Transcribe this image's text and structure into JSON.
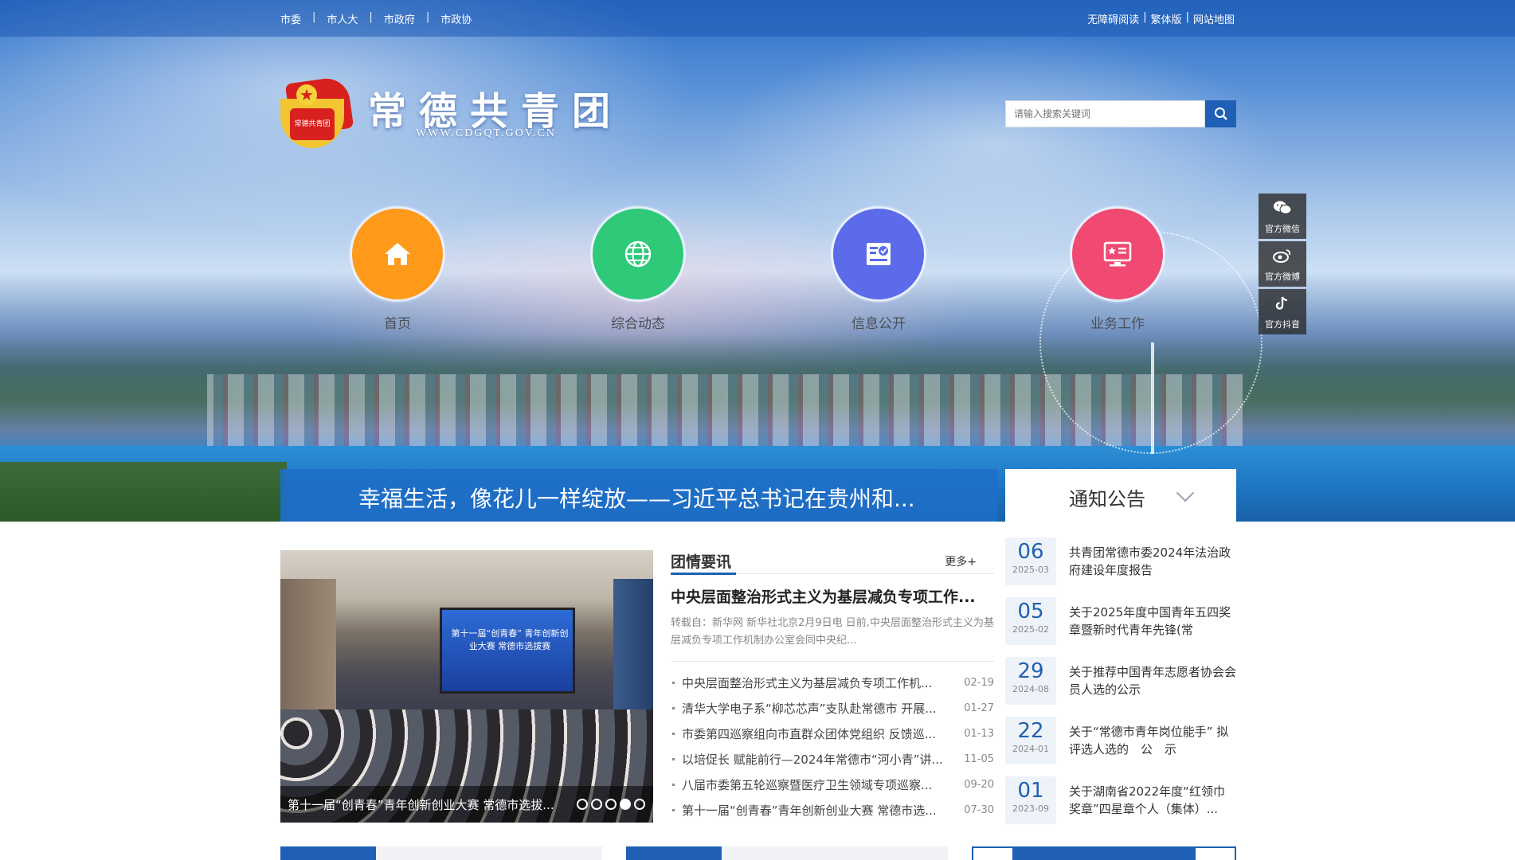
{
  "top_nav": {
    "left": [
      "市委",
      "市人大",
      "市政府",
      "市政协"
    ],
    "right": [
      "无障碍阅读",
      "繁体版",
      "网站地图"
    ]
  },
  "header": {
    "title": "常德共青团",
    "subtitle": "WWW.CDGQT.GOV.CN",
    "logo_text": "常德共青团"
  },
  "search": {
    "placeholder": "请输入搜索关键词"
  },
  "main_nav": [
    {
      "label": "首页",
      "color": "#ff9a1a",
      "icon": "home-icon"
    },
    {
      "label": "综合动态",
      "color": "#2fc97a",
      "icon": "globe-icon"
    },
    {
      "label": "信息公开",
      "color": "#5b6bea",
      "icon": "document-check-icon"
    },
    {
      "label": "业务工作",
      "color": "#f04a72",
      "icon": "monitor-star-icon"
    }
  ],
  "side_float": [
    {
      "label": "官方微信",
      "icon": "wechat-icon"
    },
    {
      "label": "官方微博",
      "icon": "weibo-icon"
    },
    {
      "label": "官方抖音",
      "icon": "douyin-icon"
    }
  ],
  "headline": {
    "text": "幸福生活，像花儿一样绽放——习近平总书记在贵州和..."
  },
  "notice_tab": {
    "label": "通知公告"
  },
  "slider": {
    "caption": "第十一届“创青春”青年创新创业大赛 常德市选拔...",
    "screen_text": "第十一届“创青春” 青年创新创业大赛 常德市选拔赛",
    "dots": 5,
    "active_dot": 4
  },
  "news": {
    "heading": "团情要讯",
    "more": "更多+",
    "top_title": "中央层面整治形式主义为基层减负专项工作...",
    "top_summary": "转载自：新华网 新华社北京2月9日电 日前,中央层面整治形式主义为基层减负专项工作机制办公室会同中央纪...",
    "items": [
      {
        "title": "中央层面整治形式主义为基层减负专项工作机...",
        "date": "02-19"
      },
      {
        "title": "清华大学电子系“柳芯芯声”支队赴常德市 开展...",
        "date": "01-27"
      },
      {
        "title": "市委第四巡察组向市直群众团体党组织 反馈巡...",
        "date": "01-13"
      },
      {
        "title": "以培促长 赋能前行—2024年常德市“河小青”讲...",
        "date": "11-05"
      },
      {
        "title": "八届市委第五轮巡察暨医疗卫生领域专项巡察...",
        "date": "09-20"
      },
      {
        "title": "第十一届“创青春”青年创新创业大赛 常德市选...",
        "date": "07-30"
      }
    ]
  },
  "notices": [
    {
      "day": "06",
      "ym": "2025-03",
      "title": "共青团常德市委2024年法治政府建设年度报告"
    },
    {
      "day": "05",
      "ym": "2025-02",
      "title": "关于2025年度中国青年五四奖章暨新时代青年先锋(常"
    },
    {
      "day": "29",
      "ym": "2024-08",
      "title": "关于推荐中国青年志愿者协会会员人选的公示"
    },
    {
      "day": "22",
      "ym": "2024-01",
      "title": "关于“常德市青年岗位能手” 拟评选人选的　公　示"
    },
    {
      "day": "01",
      "ym": "2023-09",
      "title": "关于湖南省2022年度“红领巾奖章”四星章个人（集体）..."
    }
  ],
  "colors": {
    "primary": "#1f5fb5",
    "topbar": "#1e5ab4"
  }
}
